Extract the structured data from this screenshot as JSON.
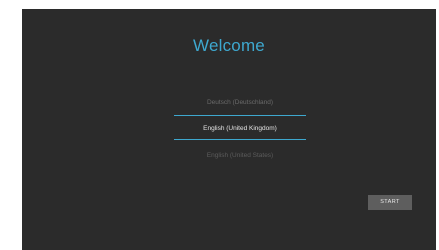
{
  "welcome": {
    "title": "Welcome"
  },
  "language_picker": {
    "previous": "Deutsch (Deutschland)",
    "selected": "English (United Kingdom)",
    "next": "English (United States)",
    "accent_color": "#3ea8cf"
  },
  "actions": {
    "start_label": "START"
  }
}
